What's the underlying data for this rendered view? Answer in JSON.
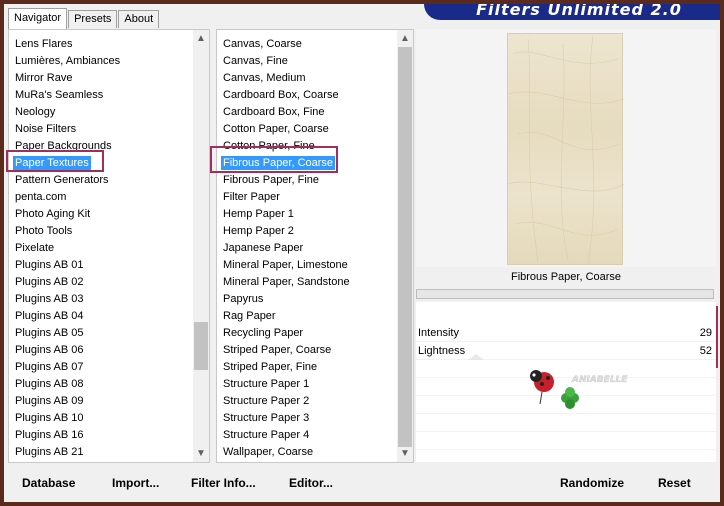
{
  "tabs": [
    "Navigator",
    "Presets",
    "About"
  ],
  "banner": {
    "title": "Filters Unlimited 2.0"
  },
  "categories": {
    "items": [
      "Lens Flares",
      "Lumières, Ambiances",
      "Mirror Rave",
      "MuRa's Seamless",
      "Neology",
      "Noise Filters",
      "Paper Backgrounds",
      "Paper Textures",
      "Pattern Generators",
      "penta.com",
      "Photo Aging Kit",
      "Photo Tools",
      "Pixelate",
      "Plugins AB 01",
      "Plugins AB 02",
      "Plugins AB 03",
      "Plugins AB 04",
      "Plugins AB 05",
      "Plugins AB 06",
      "Plugins AB 07",
      "Plugins AB 08",
      "Plugins AB 09",
      "Plugins AB 10",
      "Plugins AB 16",
      "Plugins AB 21"
    ],
    "selected_index": 7
  },
  "filters": {
    "items": [
      "Canvas, Coarse",
      "Canvas, Fine",
      "Canvas, Medium",
      "Cardboard Box, Coarse",
      "Cardboard Box, Fine",
      "Cotton Paper, Coarse",
      "Cotton Paper, Fine",
      "Fibrous Paper, Coarse",
      "Fibrous Paper, Fine",
      "Filter Paper",
      "Hemp Paper 1",
      "Hemp Paper 2",
      "Japanese Paper",
      "Mineral Paper, Limestone",
      "Mineral Paper, Sandstone",
      "Papyrus",
      "Rag Paper",
      "Recycling Paper",
      "Striped Paper, Coarse",
      "Striped Paper, Fine",
      "Structure Paper 1",
      "Structure Paper 2",
      "Structure Paper 3",
      "Structure Paper 4",
      "Wallpaper, Coarse"
    ],
    "selected_index": 7
  },
  "preview": {
    "filter_name": "Fibrous Paper, Coarse"
  },
  "params": [
    {
      "label": "Intensity",
      "value": "29"
    },
    {
      "label": "Lightness",
      "value": "52"
    }
  ],
  "logo_text": "ANIABELLE",
  "buttons": {
    "database": "Database",
    "import": "Import...",
    "filter_info": "Filter Info...",
    "editor": "Editor...",
    "randomize": "Randomize",
    "reset": "Reset"
  },
  "colors": {
    "highlight": "#a0305a",
    "selection": "#3399ff",
    "banner": "#1a2a8a"
  }
}
